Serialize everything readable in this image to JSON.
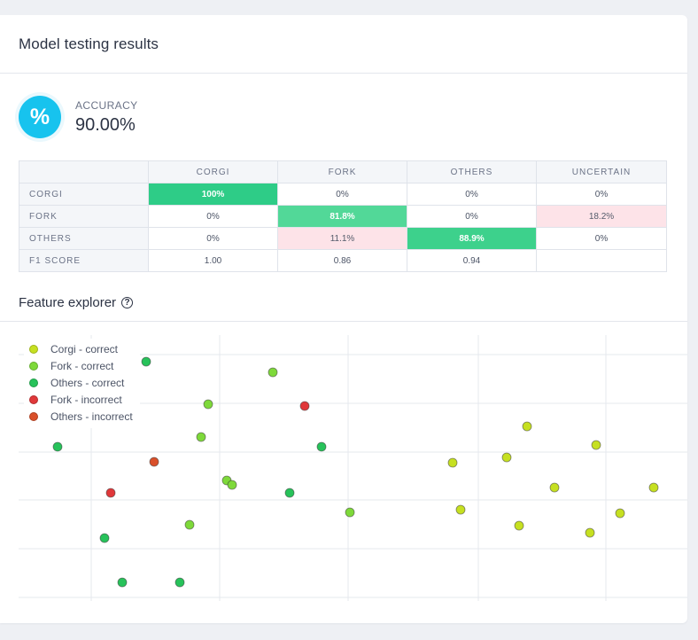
{
  "card": {
    "title": "Model testing results"
  },
  "accuracy": {
    "icon": "percent-icon",
    "icon_glyph": "%",
    "label": "ACCURACY",
    "value": "90.00%",
    "icon_color": "#17c3ee"
  },
  "matrix": {
    "columns": [
      "CORGI",
      "FORK",
      "OTHERS",
      "UNCERTAIN"
    ],
    "rows": [
      {
        "label": "CORGI",
        "cells": [
          "100%",
          "0%",
          "0%",
          "0%"
        ]
      },
      {
        "label": "FORK",
        "cells": [
          "0%",
          "81.8%",
          "0%",
          "18.2%"
        ]
      },
      {
        "label": "OTHERS",
        "cells": [
          "0%",
          "11.1%",
          "88.9%",
          "0%"
        ]
      },
      {
        "label": "F1 SCORE",
        "cells": [
          "1.00",
          "0.86",
          "0.94",
          ""
        ]
      }
    ],
    "colors": {
      "correct_high": "#2ecc87",
      "incorrect": "#fde3e8"
    }
  },
  "feature_explorer": {
    "title": "Feature explorer",
    "help_icon": "help-circle-icon",
    "help_glyph": "?"
  },
  "chart_data": {
    "type": "scatter",
    "title": "",
    "xlabel": "",
    "ylabel": "",
    "grid": true,
    "legend_position": "top-left",
    "series": [
      {
        "name": "Corgi - correct",
        "color": "#c6e021",
        "points": [
          [
            511,
            522
          ],
          [
            572,
            516
          ],
          [
            595,
            481
          ],
          [
            673,
            502
          ],
          [
            626,
            550
          ],
          [
            738,
            550
          ],
          [
            520,
            575
          ],
          [
            586,
            593
          ],
          [
            666,
            601
          ],
          [
            700,
            579
          ]
        ]
      },
      {
        "name": "Fork - correct",
        "color": "#7ed93a",
        "points": [
          [
            308,
            420
          ],
          [
            235,
            456
          ],
          [
            227,
            493
          ],
          [
            256,
            542
          ],
          [
            262,
            547
          ],
          [
            214,
            592
          ],
          [
            395,
            578
          ]
        ]
      },
      {
        "name": "Others - correct",
        "color": "#27c25a",
        "points": [
          [
            165,
            408
          ],
          [
            65,
            504
          ],
          [
            363,
            504
          ],
          [
            327,
            556
          ],
          [
            118,
            607
          ],
          [
            138,
            657
          ],
          [
            203,
            657
          ]
        ]
      },
      {
        "name": "Fork - incorrect",
        "color": "#e0383a",
        "points": [
          [
            344,
            458
          ],
          [
            125,
            556
          ]
        ]
      },
      {
        "name": "Others - incorrect",
        "color": "#d9502a",
        "points": [
          [
            174,
            521
          ]
        ]
      }
    ]
  }
}
